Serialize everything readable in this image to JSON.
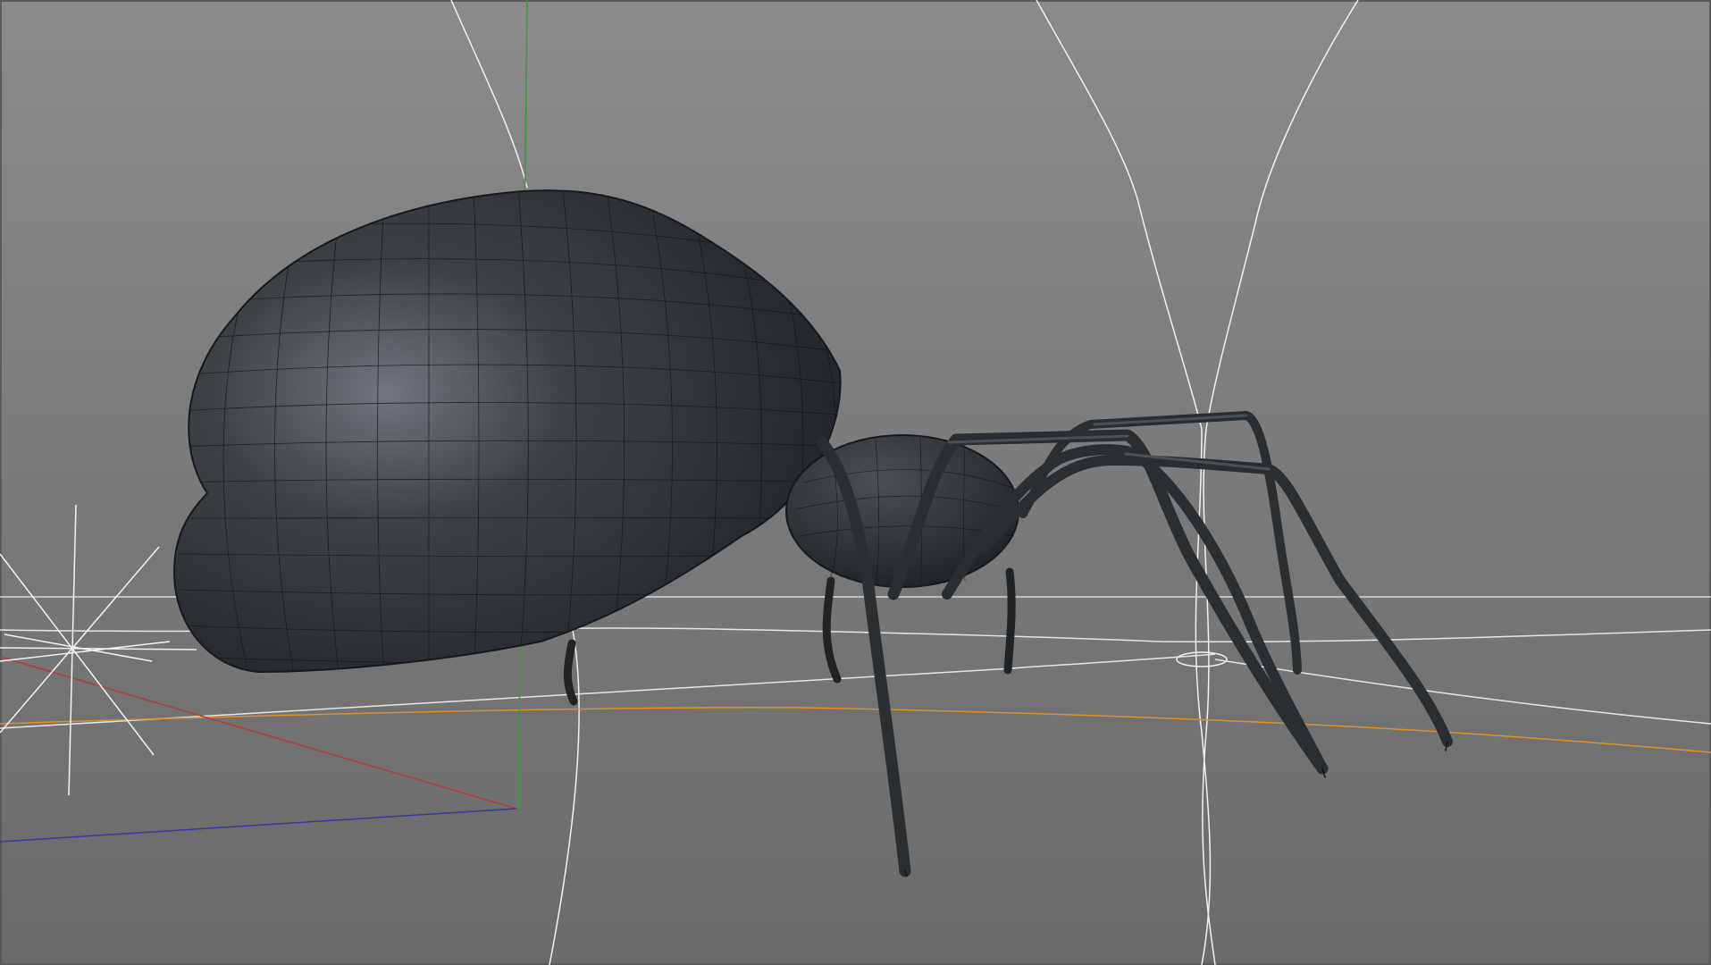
{
  "viewport": {
    "view": "perspective",
    "object": "spider",
    "shading": "gouraud-lines",
    "icons": {
      "light": "light-icon",
      "axis": "world-axis-icon"
    },
    "colors": {
      "background_top": "#8b8b8b",
      "background_bottom": "#6a6a6a",
      "mesh_fill": "#2b2f33",
      "mesh_highlight": "#6f7478",
      "wire": "#15181b",
      "guide_lines": "#f2f2f2",
      "axis_x": "#b23a3a",
      "axis_y": "#3a9a3a",
      "axis_z": "#3a3aa8",
      "horizon": "#e0902a"
    }
  }
}
